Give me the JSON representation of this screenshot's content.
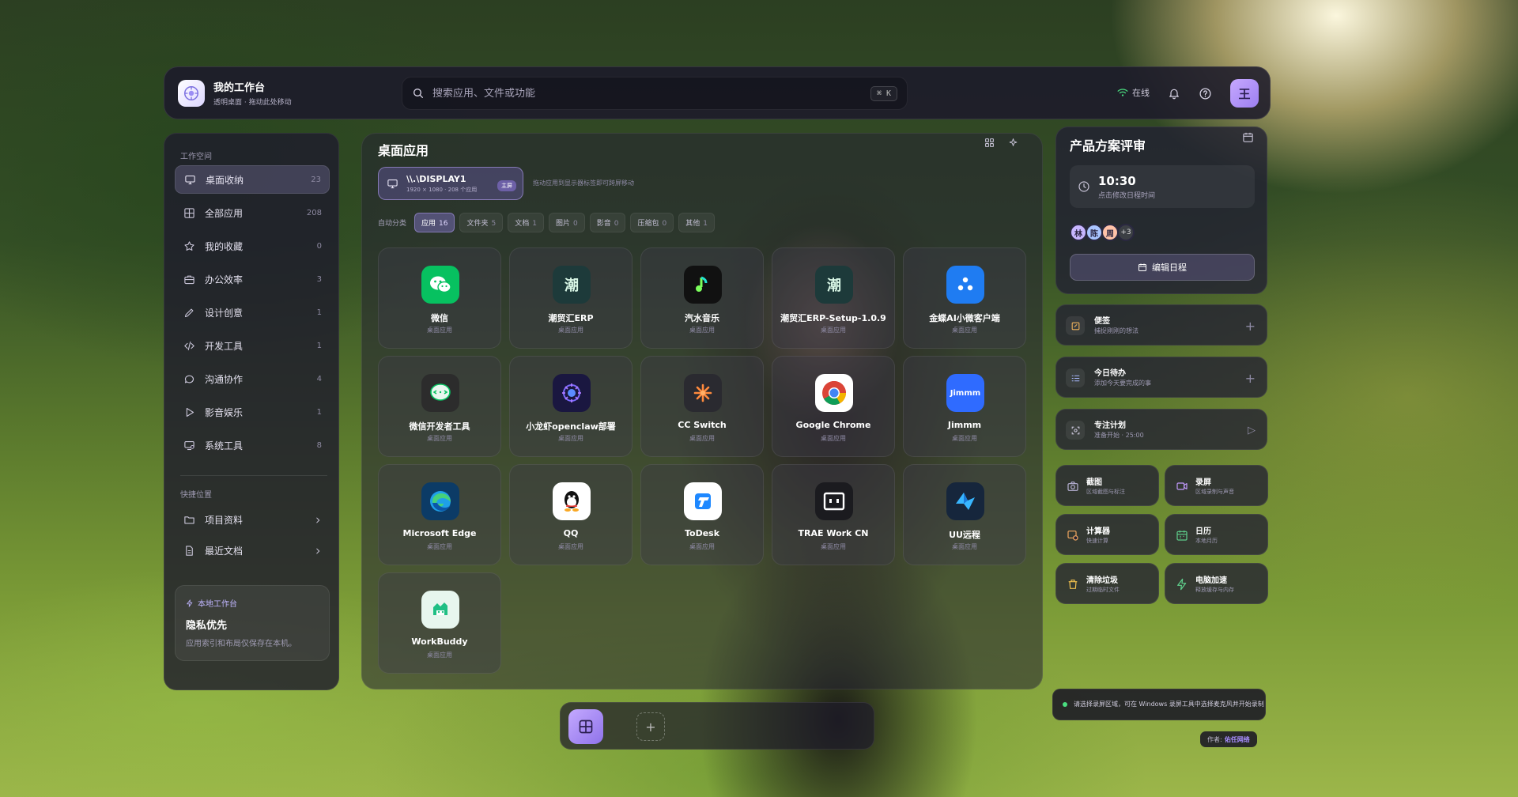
{
  "topbar": {
    "brand_title": "我的工作台",
    "brand_subtitle": "透明桌面 · 拖动此处移动",
    "search_placeholder": "搜索应用、文件或功能",
    "shortcut": "⌘ K",
    "status": "在线",
    "avatar_initial": "王"
  },
  "sidebar": {
    "section_workspace": "工作空间",
    "items": [
      {
        "label": "桌面收纳",
        "count": "23",
        "icon": "monitor-icon"
      },
      {
        "label": "全部应用",
        "count": "208",
        "icon": "grid-icon"
      },
      {
        "label": "我的收藏",
        "count": "0",
        "icon": "star-icon"
      },
      {
        "label": "办公效率",
        "count": "3",
        "icon": "briefcase-icon"
      },
      {
        "label": "设计创意",
        "count": "1",
        "icon": "pen-icon"
      },
      {
        "label": "开发工具",
        "count": "1",
        "icon": "code-icon"
      },
      {
        "label": "沟通协作",
        "count": "4",
        "icon": "chat-icon"
      },
      {
        "label": "影音娱乐",
        "count": "1",
        "icon": "play-icon"
      },
      {
        "label": "系统工具",
        "count": "8",
        "icon": "system-icon"
      }
    ],
    "section_quick": "快捷位置",
    "quick": [
      {
        "label": "项目资料",
        "icon": "folder-icon"
      },
      {
        "label": "最近文档",
        "icon": "document-icon"
      }
    ],
    "privacy": {
      "tag": "本地工作台",
      "title": "隐私优先",
      "desc": "应用索引和布局仅保存在本机。"
    }
  },
  "main": {
    "title": "桌面应用",
    "display": {
      "name": "\\\\.\\DISPLAY1",
      "sub": "1920 × 1080 · 208 个应用",
      "badge": "主屏",
      "hint": "拖动应用到显示器标签即可跨屏移动"
    },
    "filter_label": "自动分类",
    "filters": [
      {
        "label": "应用",
        "count": "16"
      },
      {
        "label": "文件夹",
        "count": "5"
      },
      {
        "label": "文档",
        "count": "1"
      },
      {
        "label": "图片",
        "count": "0"
      },
      {
        "label": "影音",
        "count": "0"
      },
      {
        "label": "压缩包",
        "count": "0"
      },
      {
        "label": "其他",
        "count": "1"
      }
    ],
    "apps": [
      {
        "name": "微信",
        "kind": "桌面应用",
        "glyph": "",
        "icon": "wechat-icon",
        "bg": "#07c160"
      },
      {
        "name": "潮贸汇ERP",
        "kind": "桌面应用",
        "glyph": "潮",
        "icon": "chaomaohui-icon",
        "bg": "#1d3a3a"
      },
      {
        "name": "汽水音乐",
        "kind": "桌面应用",
        "glyph": "",
        "icon": "music-icon",
        "bg": "#111111"
      },
      {
        "name": "潮贸汇ERP-Setup-1.0.9",
        "kind": "桌面应用",
        "glyph": "潮",
        "icon": "chaomaohui-setup-icon",
        "bg": "#1d3a3a"
      },
      {
        "name": "金蝶AI小微客户端",
        "kind": "桌面应用",
        "glyph": "",
        "icon": "kingdee-icon",
        "bg": "#1f7cf2"
      },
      {
        "name": "微信开发者工具",
        "kind": "桌面应用",
        "glyph": "",
        "icon": "wechat-devtools-icon",
        "bg": "#2c2c2c"
      },
      {
        "name": "小龙虾openclaw部署",
        "kind": "桌面应用",
        "glyph": "",
        "icon": "openclaw-icon",
        "bg": "#1a1740"
      },
      {
        "name": "CC Switch",
        "kind": "桌面应用",
        "glyph": "",
        "icon": "cc-switch-icon",
        "bg": "#2a2a30"
      },
      {
        "name": "Google Chrome",
        "kind": "桌面应用",
        "glyph": "",
        "icon": "chrome-icon",
        "bg": "#ffffff"
      },
      {
        "name": "Jimmm",
        "kind": "桌面应用",
        "glyph": "Jimmm",
        "icon": "jimmm-icon",
        "bg": "#2f6bff"
      },
      {
        "name": "Microsoft Edge",
        "kind": "桌面应用",
        "glyph": "",
        "icon": "edge-icon",
        "bg": "#0c3b66"
      },
      {
        "name": "QQ",
        "kind": "桌面应用",
        "glyph": "",
        "icon": "qq-icon",
        "bg": "#ffffff"
      },
      {
        "name": "ToDesk",
        "kind": "桌面应用",
        "glyph": "",
        "icon": "todesk-icon",
        "bg": "#ffffff"
      },
      {
        "name": "TRAE Work CN",
        "kind": "桌面应用",
        "glyph": "",
        "icon": "trae-icon",
        "bg": "#1b1b1f"
      },
      {
        "name": "UU远程",
        "kind": "桌面应用",
        "glyph": "",
        "icon": "uu-remote-icon",
        "bg": "#16263c"
      },
      {
        "name": "WorkBuddy",
        "kind": "桌面应用",
        "glyph": "",
        "icon": "workbuddy-icon",
        "bg": "#e7f6ee"
      }
    ]
  },
  "right": {
    "meeting": {
      "title": "产品方案评审",
      "time": "10:30",
      "time_hint": "点击修改日程时间",
      "people": [
        "林",
        "陈",
        "周"
      ],
      "more": "+3",
      "edit_label": "编辑日程"
    },
    "widgets": [
      {
        "title": "便签",
        "sub": "捕捉刚刚的想法",
        "icon": "note-icon",
        "action": "+"
      },
      {
        "title": "今日待办",
        "sub": "添加今天要完成的事",
        "icon": "todo-icon",
        "action": "+"
      },
      {
        "title": "专注计划",
        "sub": "准备开始 · 25:00",
        "icon": "focus-icon",
        "action": "▷"
      }
    ],
    "tiles": [
      {
        "title": "截图",
        "sub": "区域截图与标注",
        "icon": "camera-icon",
        "color": "#b9b3d6"
      },
      {
        "title": "录屏",
        "sub": "区域录制与声音",
        "icon": "video-icon",
        "color": "#c39bff"
      },
      {
        "title": "计算器",
        "sub": "快速计算",
        "icon": "calculator-icon",
        "color": "#f4a860"
      },
      {
        "title": "日历",
        "sub": "本地月历",
        "icon": "calendar-icon",
        "color": "#5fd08c"
      },
      {
        "title": "清除垃圾",
        "sub": "过期临时文件",
        "icon": "trash-icon",
        "color": "#f2c14e"
      },
      {
        "title": "电脑加速",
        "sub": "释放缓存与内存",
        "icon": "lightning-icon",
        "color": "#5fd08c"
      }
    ],
    "toast": "请选择录屏区域，可在 Windows 录屏工具中选择麦克风并开始录制",
    "author_label": "作者:",
    "author_name": "佑任网络"
  }
}
